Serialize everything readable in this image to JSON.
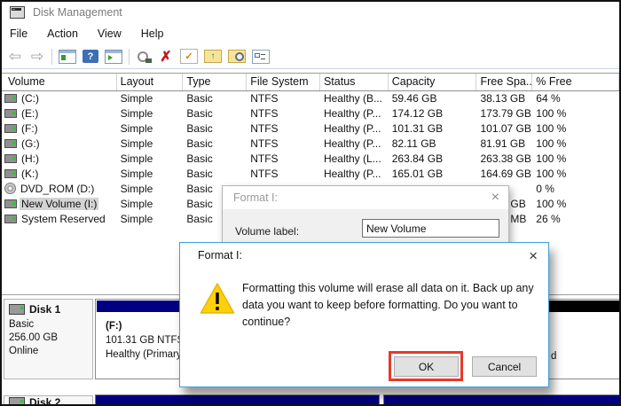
{
  "window": {
    "title": "Disk Management"
  },
  "menu": {
    "items": [
      "File",
      "Action",
      "View",
      "Help"
    ]
  },
  "toolbar": {
    "icons": [
      "back-arrow",
      "forward-arrow",
      "separator",
      "console-window",
      "help",
      "console-play",
      "separator",
      "magnifier-disk",
      "delete-x",
      "document-check",
      "folder-up",
      "folder-search",
      "properties-list"
    ]
  },
  "volume_table": {
    "columns": [
      "Volume",
      "Layout",
      "Type",
      "File System",
      "Status",
      "Capacity",
      "Free Spa...",
      "% Free"
    ],
    "rows": [
      {
        "icon": "disk",
        "volume": "(C:)",
        "layout": "Simple",
        "type": "Basic",
        "fs": "NTFS",
        "status": "Healthy (B...",
        "capacity": "59.46 GB",
        "free": "38.13 GB",
        "pct": "64 %",
        "selected": false
      },
      {
        "icon": "disk",
        "volume": "(E:)",
        "layout": "Simple",
        "type": "Basic",
        "fs": "NTFS",
        "status": "Healthy (P...",
        "capacity": "174.12 GB",
        "free": "173.79 GB",
        "pct": "100 %",
        "selected": false
      },
      {
        "icon": "disk",
        "volume": "(F:)",
        "layout": "Simple",
        "type": "Basic",
        "fs": "NTFS",
        "status": "Healthy (P...",
        "capacity": "101.31 GB",
        "free": "101.07 GB",
        "pct": "100 %",
        "selected": false
      },
      {
        "icon": "disk",
        "volume": "(G:)",
        "layout": "Simple",
        "type": "Basic",
        "fs": "NTFS",
        "status": "Healthy (P...",
        "capacity": "82.11 GB",
        "free": "81.91 GB",
        "pct": "100 %",
        "selected": false
      },
      {
        "icon": "disk",
        "volume": "(H:)",
        "layout": "Simple",
        "type": "Basic",
        "fs": "NTFS",
        "status": "Healthy (L...",
        "capacity": "263.84 GB",
        "free": "263.38 GB",
        "pct": "100 %",
        "selected": false
      },
      {
        "icon": "disk",
        "volume": "(K:)",
        "layout": "Simple",
        "type": "Basic",
        "fs": "NTFS",
        "status": "Healthy (P...",
        "capacity": "165.01 GB",
        "free": "164.69 GB",
        "pct": "100 %",
        "selected": false
      },
      {
        "icon": "dvd",
        "volume": "DVD_ROM (D:)",
        "layout": "Simple",
        "type": "Basic",
        "fs": "",
        "status": "",
        "capacity": "",
        "free": "",
        "pct": "0 %",
        "selected": false
      },
      {
        "icon": "disk",
        "volume": "New Volume (I:)",
        "layout": "Simple",
        "type": "Basic",
        "fs": "",
        "status": "",
        "capacity": "",
        "free": "GB",
        "pct": "100 %",
        "selected": true
      },
      {
        "icon": "disk",
        "volume": "System Reserved",
        "layout": "Simple",
        "type": "Basic",
        "fs": "",
        "status": "",
        "capacity": "",
        "free": "MB",
        "pct": "26 %",
        "selected": false
      }
    ]
  },
  "format_label_dialog": {
    "title": "Format I:",
    "close": "×",
    "volume_label": "Volume label:",
    "volume_value": "New Volume"
  },
  "format_confirm_dialog": {
    "title": "Format I:",
    "close": "×",
    "message_lines": [
      "Formatting this volume will erase all data on it. Back up any",
      "data you want to keep before formatting. Do you want to",
      "continue?"
    ],
    "ok_label": "OK",
    "cancel_label": "Cancel"
  },
  "disk_graph": {
    "disk1": {
      "name": "Disk 1",
      "type": "Basic",
      "size": "256.00 GB",
      "status": "Online",
      "partition_f": {
        "name": "(F:)",
        "size_fs": "101.31 GB NTFS",
        "status": "Healthy (Primary Pa"
      },
      "unallocated_fragment": "d"
    },
    "disk2": {
      "name": "Disk 2"
    }
  },
  "colors": {
    "accent_dialog_border": "#3f9edb",
    "annotation_red": "#e8392b",
    "partition_primary_navy": "#000080",
    "unallocated_black": "#000000",
    "warning_yellow": "#fdd108"
  }
}
